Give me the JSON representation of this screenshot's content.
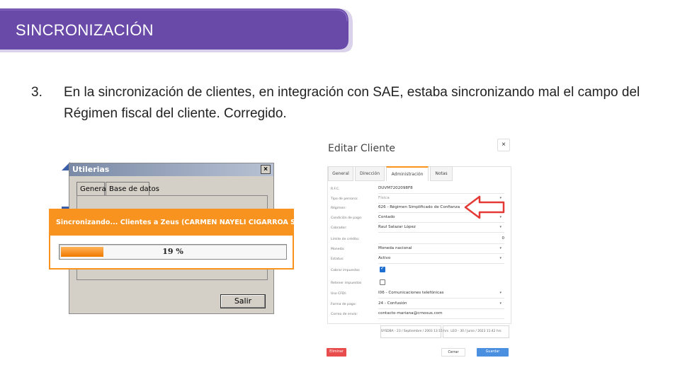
{
  "header": {
    "title": "SINCRONIZACIÓN"
  },
  "point": {
    "number": "3.",
    "text": "En la sincronización de clientes, en integración con SAE, estaba sincronizando mal el campo del Régimen fiscal del cliente. Corregido."
  },
  "utilerias": {
    "title": "Utilerias",
    "close": "×",
    "tabs": [
      "General",
      "Base de datos"
    ],
    "exit_button": "Salir"
  },
  "sync": {
    "message": "Sincronizando... Clientes a Zeus (CARMEN NAYELI CIGARROA SALAZAR)",
    "progress_percent": 19,
    "progress_label": "19 %"
  },
  "edit": {
    "title": "Editar Cliente",
    "close": "×",
    "tabs": [
      "General",
      "Dirección",
      "Administración",
      "Notas"
    ],
    "active_tab": "Administración",
    "fields": [
      {
        "label": "R.F.C.",
        "value": "DUVM7202098F8"
      },
      {
        "label": "Tipo de persona:",
        "value": "Física"
      },
      {
        "label": "Régimen:",
        "value": "626 - Régimen Simplificado de Confianza"
      },
      {
        "label": "Condición de pago:",
        "value": "Contado"
      },
      {
        "label": "Cobrador:",
        "value": "Raul Salazar López"
      },
      {
        "label": "Límite de crédito:",
        "value": "0"
      },
      {
        "label": "Moneda:",
        "value": "Moneda nacional"
      },
      {
        "label": "Estatus:",
        "value": "Activo"
      },
      {
        "label": "Cobrar impuestos",
        "value": ""
      },
      {
        "label": "Retener impuestos",
        "value": ""
      },
      {
        "label": "Uso CFDI:",
        "value": "I06 - Comunicaciones telefónicas"
      },
      {
        "label": "Forma de pago:",
        "value": "24 - Confusión"
      },
      {
        "label": "Correo de envío:",
        "value": "contacto-mariana@crnosus.com"
      }
    ],
    "footer_created": "SYSDBA - 23 / Septiembre / 2003 13:15 hrs",
    "footer_modified": "LEO - 30 / Junio / 2023 11:42 hrs",
    "delete_button": "Eliminar",
    "cancel_button": "Cerrar",
    "save_button": "Guardar"
  },
  "colors": {
    "banner": "#6a4aa8",
    "banner_border": "#7d5fc0",
    "orange": "#f7931e",
    "arrow": "#e53935"
  }
}
